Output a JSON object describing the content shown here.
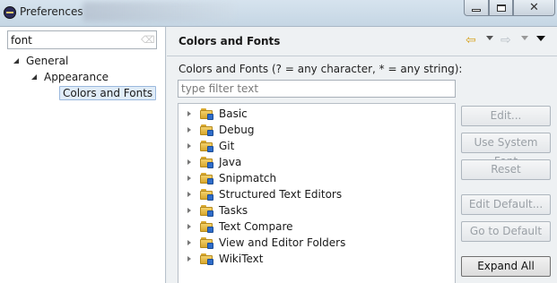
{
  "window": {
    "title": "Preferences",
    "controls": {
      "minimize_icon": "minimize-icon",
      "maximize_icon": "maximize-icon",
      "close_icon": "close-icon",
      "close_glyph": "✕"
    }
  },
  "left": {
    "search_value": "font",
    "clear_glyph": "⌫",
    "tree": [
      {
        "label": "General",
        "expanded": true
      },
      {
        "label": "Appearance",
        "expanded": true
      },
      {
        "label": "Colors and Fonts",
        "selected": true
      }
    ]
  },
  "main": {
    "title": "Colors and Fonts",
    "nav": {
      "back_glyph": "⇦",
      "forward_glyph": "⇨"
    },
    "description": "Colors and Fonts (? = any character, * = any string):",
    "filter_placeholder": "type filter text",
    "categories": [
      "Basic",
      "Debug",
      "Git",
      "Java",
      "Snipmatch",
      "Structured Text Editors",
      "Tasks",
      "Text Compare",
      "View and Editor Folders",
      "WikiText"
    ],
    "buttons": {
      "edit": "Edit...",
      "use_system_font": "Use System Font",
      "reset": "Reset",
      "edit_default": "Edit Default...",
      "go_to_default": "Go to Default",
      "expand_all": "Expand All"
    }
  },
  "colors": {
    "folder": "#e8b94a",
    "selection": "#e0ecf8",
    "nav_back": "#d6a21e"
  }
}
